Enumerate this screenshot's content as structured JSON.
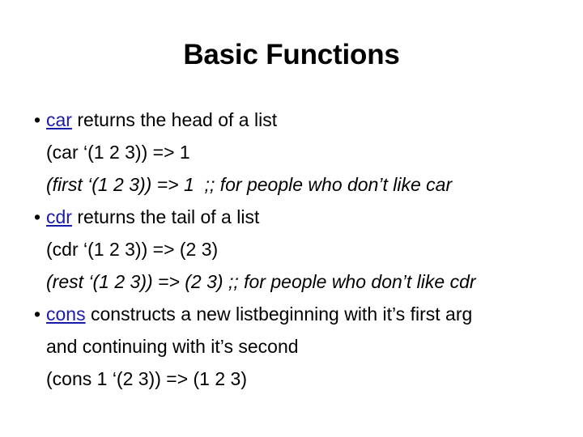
{
  "slide": {
    "title": "Basic Functions",
    "bullet_glyph": "•",
    "link_color": "#1B1BAA",
    "text_color": "#000000",
    "background_color": "#FFFFFF",
    "lines": [
      {
        "id": "car-description",
        "bulleted": true,
        "italic": false,
        "link": "car",
        "text": " returns the head of a list"
      },
      {
        "id": "car-example",
        "bulleted": false,
        "italic": false,
        "link": "",
        "text": "(car ‘(1 2 3)) => 1"
      },
      {
        "id": "first-example",
        "bulleted": false,
        "italic": true,
        "link": "",
        "text": "(first ‘(1 2 3)) => 1  ;; for people who don’t like car"
      },
      {
        "id": "cdr-description",
        "bulleted": true,
        "italic": false,
        "link": "cdr",
        "text": " returns the tail of a list"
      },
      {
        "id": "cdr-example",
        "bulleted": false,
        "italic": false,
        "link": "",
        "text": "(cdr ‘(1 2 3)) => (2 3)"
      },
      {
        "id": "rest-example",
        "bulleted": false,
        "italic": true,
        "link": "",
        "text": "(rest ‘(1 2 3)) => (2 3) ;; for people who don’t like cdr"
      },
      {
        "id": "cons-description",
        "bulleted": true,
        "italic": false,
        "link": "cons",
        "text": " constructs a new listbeginning with it’s first arg"
      },
      {
        "id": "cons-description-cont",
        "bulleted": false,
        "italic": false,
        "link": "",
        "text": "and continuing with it’s second"
      },
      {
        "id": "cons-example",
        "bulleted": false,
        "italic": false,
        "link": "",
        "text": "(cons 1 ‘(2 3)) => (1 2 3)"
      }
    ]
  }
}
